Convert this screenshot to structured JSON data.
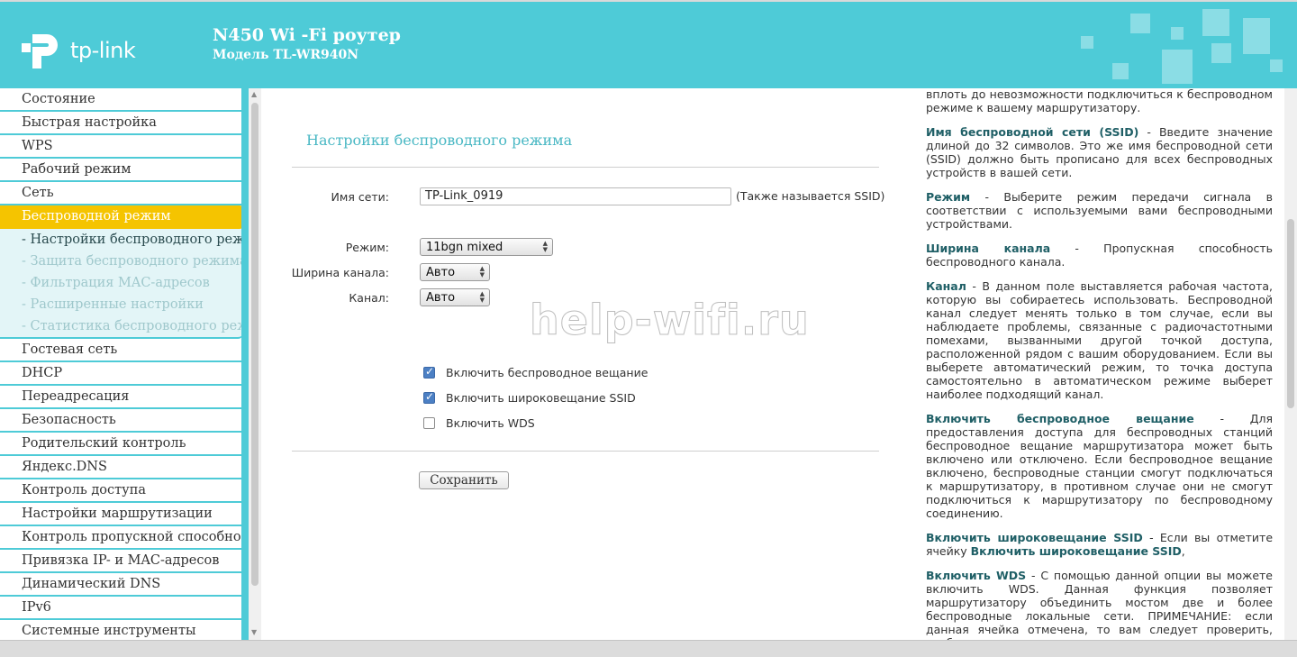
{
  "header": {
    "brand": "tp-link",
    "model_title": "N450 Wi -Fi роутер",
    "model_sub": "Модель TL-WR940N"
  },
  "sidebar": {
    "items_top": [
      {
        "label": "Состояние"
      },
      {
        "label": "Быстрая настройка"
      },
      {
        "label": "WPS"
      },
      {
        "label": "Рабочий режим"
      },
      {
        "label": "Сеть"
      }
    ],
    "active": {
      "label": "Беспроводной режим"
    },
    "sub_items": [
      {
        "label": "- Настройки беспроводного режима"
      },
      {
        "label": "- Защита беспроводного режима"
      },
      {
        "label": "- Фильтрация MAC-адресов"
      },
      {
        "label": "- Расширенные настройки"
      },
      {
        "label": "- Статистика беспроводного режима"
      }
    ],
    "items_bottom": [
      {
        "label": "Гостевая сеть"
      },
      {
        "label": "DHCP"
      },
      {
        "label": "Переадресация"
      },
      {
        "label": "Безопасность"
      },
      {
        "label": "Родительский контроль"
      },
      {
        "label": "Яндекс.DNS"
      },
      {
        "label": "Контроль доступа"
      },
      {
        "label": "Настройки маршрутизации"
      },
      {
        "label": "Контроль пропускной способности"
      },
      {
        "label": "Привязка IP- и MAC-адресов"
      },
      {
        "label": "Динамический DNS"
      },
      {
        "label": "IPv6"
      },
      {
        "label": "Системные инструменты"
      }
    ]
  },
  "main": {
    "title": "Настройки беспроводного режима",
    "ssid_label": "Имя сети:",
    "ssid_value": "TP-Link_0919",
    "ssid_hint": "(Также называется SSID)",
    "mode_label": "Режим:",
    "mode_value": "11bgn mixed",
    "width_label": "Ширина канала:",
    "width_value": "Авто",
    "channel_label": "Канал:",
    "channel_value": "Авто",
    "checkboxes": [
      {
        "label": "Включить беспроводное вещание",
        "checked": true
      },
      {
        "label": "Включить широковещание SSID",
        "checked": true
      },
      {
        "label": "Включить WDS",
        "checked": false
      }
    ],
    "save_label": "Сохранить",
    "watermark": "help-wifi.ru"
  },
  "help": {
    "intro": "вплоть до невозможности подключиться к беспроводном режиме к вашему маршрутизатору.",
    "ssid_term": "Имя беспроводной сети (SSID)",
    "ssid_text": " - Введите значение длиной до 32 символов. Это же имя беспроводной сети (SSID) должно быть прописано для всех беспроводных устройств в вашей сети.",
    "mode_term": "Режим",
    "mode_text": " - Выберите режим передачи сигнала в соответствии с используемыми вами беспроводными устройствами.",
    "width_term": "Ширина канала",
    "width_text": " - Пропускная способность беспроводного канала.",
    "channel_term": "Канал",
    "channel_text": " - В данном поле выставляется рабочая частота, которую вы собираетесь использовать. Беспроводной канал следует менять только в том случае, если вы наблюдаете проблемы, связанные с радиочастотными помехами, вызванными другой точкой доступа, расположенной рядом с вашим оборудованием. Если вы выберете автоматический режим, то точка доступа самостоятельно в автоматическом режиме выберет наиболее подходящий канал.",
    "broadcast_term": "Включить беспроводное вещание",
    "broadcast_text": " - Для предоставления доступа для беспроводных станций беспроводное вещание маршрутизатора может быть включено или отключено. Если беспроводное вещание включено, беспроводные станции смогут подключаться к маршрутизатору, в противном случае они не смогут подключиться к маршрутизатору по беспроводному соединению.",
    "ssidb_term": "Включить широковещание SSID",
    "ssidb_text1": " - Если вы отметите ячейку ",
    "ssidb_term2": "Включить широковещание SSID",
    "ssidb_text2": ",",
    "wds_term": "Включить WDS",
    "wds_text": " - С помощью данной опции вы можете включить WDS. Данная функция позволяет маршрутизатору объединить мостом две и более беспроводные локальные сети. ПРИМЕЧАНИЕ: если данная ячейка отмечена, то вам следует проверить, чтобы канал совпадал с каналом точки доступа, к которой будет происходить подключение, а также проверить следующие"
  }
}
